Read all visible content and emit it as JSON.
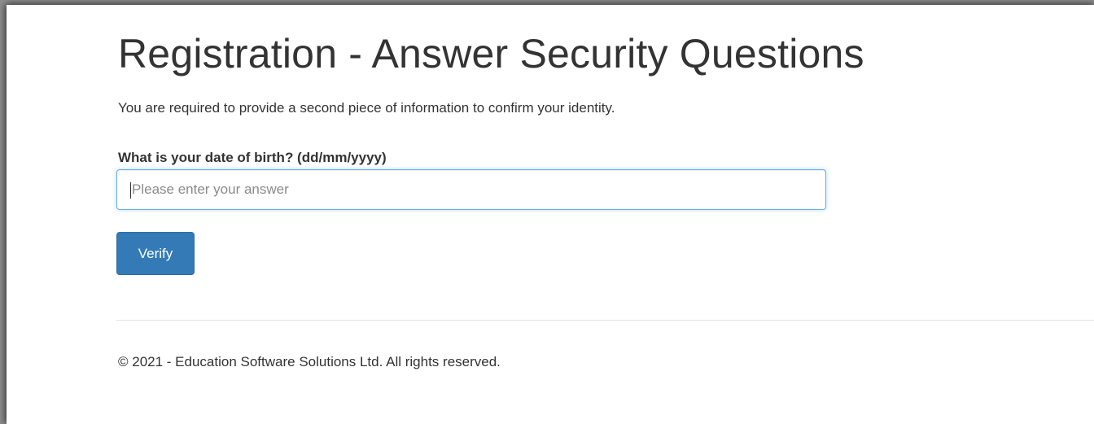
{
  "page": {
    "title": "Registration - Answer Security Questions",
    "intro": "You are required to provide a second piece of information to confirm your identity."
  },
  "form": {
    "question_label": "What is your date of birth? (dd/mm/yyyy)",
    "answer_value": "",
    "answer_placeholder": "Please enter your answer",
    "verify_label": "Verify"
  },
  "footer": {
    "copyright": "© 2021 - Education Software Solutions Ltd. All rights reserved."
  },
  "colors": {
    "primary_button": "#337ab7",
    "input_focus_border": "#66afe9",
    "text": "#333333"
  }
}
